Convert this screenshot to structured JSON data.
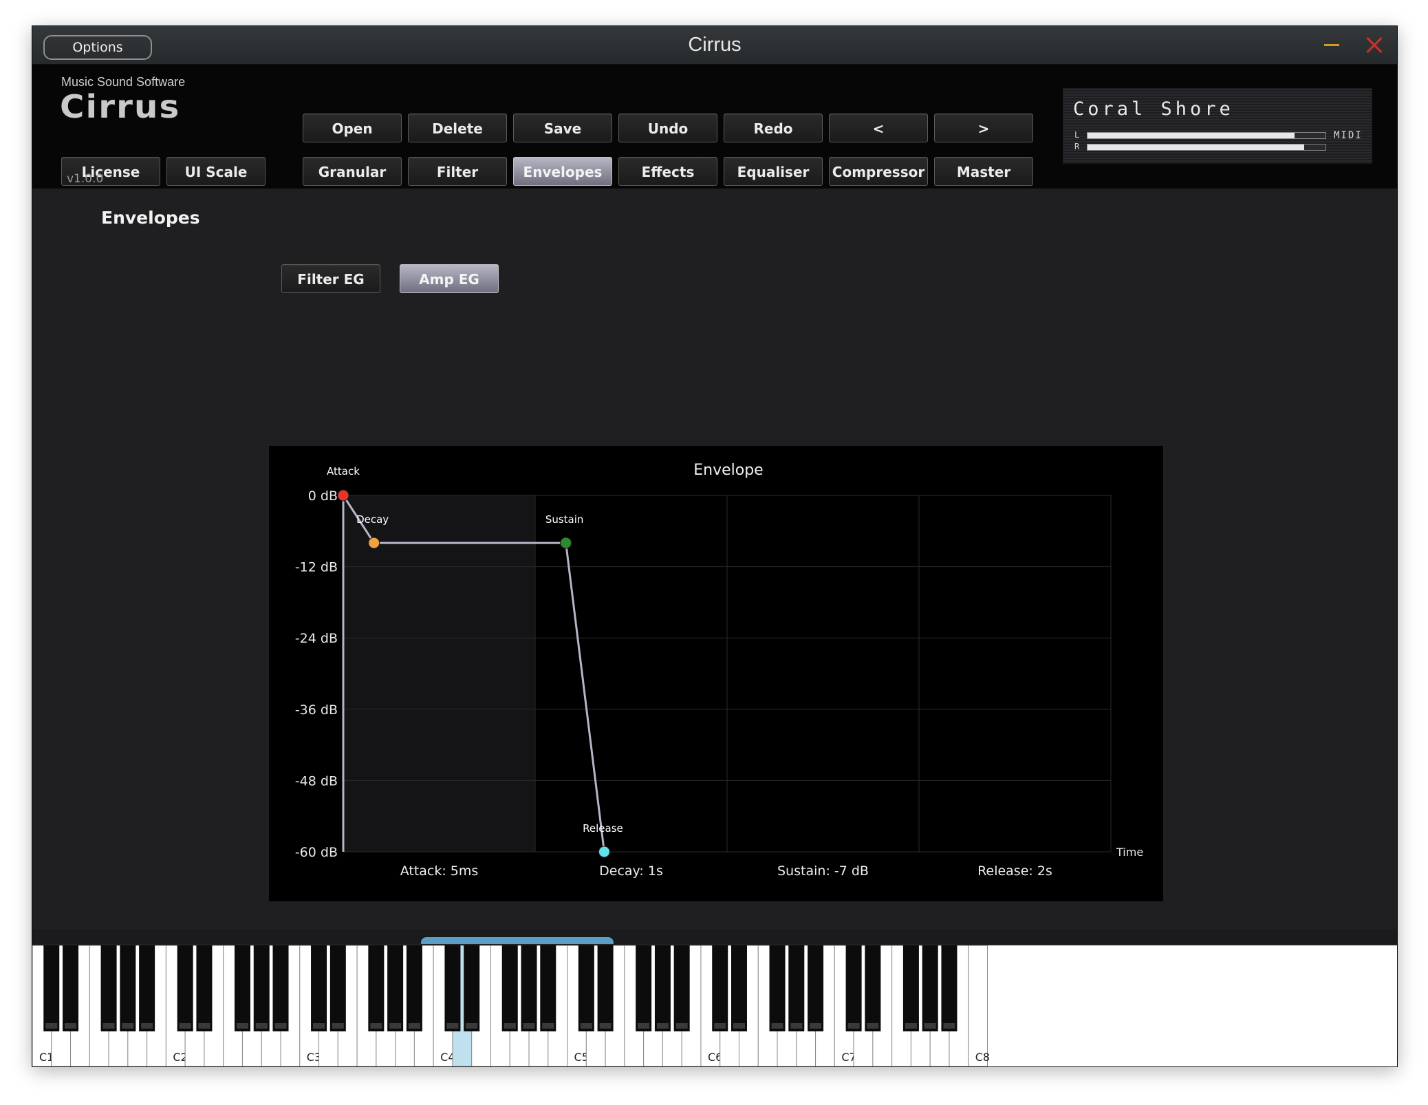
{
  "window": {
    "title": "Cirrus",
    "options_label": "Options"
  },
  "brand": {
    "vendor": "Music Sound Software",
    "logo": "Cirrus",
    "version": "v1.0.0"
  },
  "toolbar": {
    "row1": [
      "Open",
      "Delete",
      "Save",
      "Undo",
      "Redo",
      "<",
      ">"
    ],
    "row2": [
      "Granular",
      "Filter",
      "Envelopes",
      "Effects",
      "Equaliser",
      "Compressor",
      "Master"
    ],
    "active": "Envelopes",
    "license": "License",
    "ui_scale": "UI Scale"
  },
  "preset": {
    "name": "Coral Shore",
    "left_label": "L",
    "right_label": "R",
    "midi_label": "MIDI",
    "level_l": 0.87,
    "level_r": 0.91
  },
  "section": {
    "title": "Envelopes",
    "tabs": [
      "Filter EG",
      "Amp EG"
    ],
    "active_tab": "Amp EG"
  },
  "chart_data": {
    "type": "line",
    "title": "Envelope",
    "xlabel": "Time",
    "ylabel": "",
    "y_ticks": [
      "0 dB",
      "-12 dB",
      "-24 dB",
      "-36 dB",
      "-48 dB",
      "-60 dB"
    ],
    "ylim": [
      -60,
      0
    ],
    "x_columns": 4,
    "points": [
      {
        "label": "Attack",
        "x": 0.0,
        "y": 0,
        "color": "#e8342a"
      },
      {
        "label": "Decay",
        "x": 0.16,
        "y": -8,
        "color": "#f0a23c"
      },
      {
        "label": "Sustain",
        "x": 1.16,
        "y": -8,
        "color": "#2d8a2d"
      },
      {
        "label": "Release",
        "x": 1.36,
        "y": -60,
        "color": "#5fe1f0"
      }
    ],
    "start": {
      "x": 0.0,
      "y": -60
    },
    "parameters": [
      "Attack: 5ms",
      "Decay: 1s",
      "Sustain: -7 dB",
      "Release: 2s"
    ],
    "line_color": "#b7b4c9",
    "grid": true
  },
  "keyboard": {
    "octave_labels": [
      "C1",
      "C2",
      "C3",
      "C4",
      "C5",
      "C6",
      "C7",
      "C8"
    ],
    "highlight_key": "D4",
    "highlight_color": "#bfe0ef",
    "scroll_color": "#5b9ec6"
  }
}
